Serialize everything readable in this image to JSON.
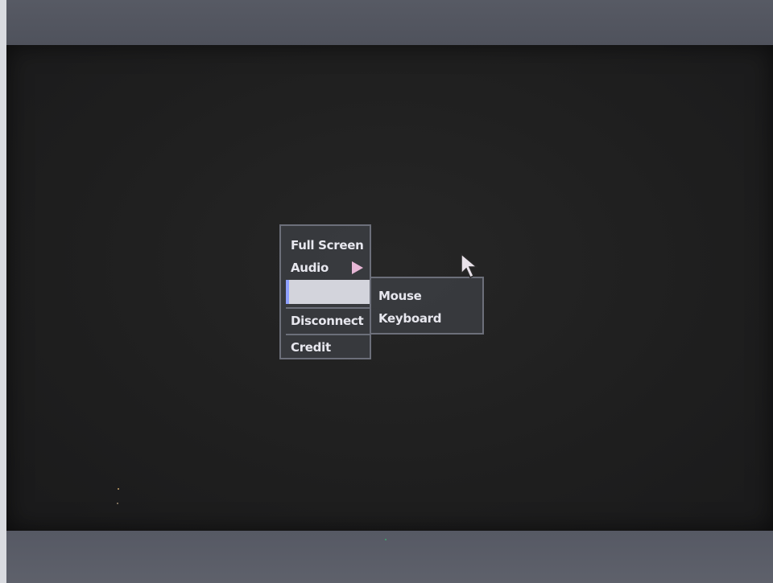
{
  "context_menu": {
    "items": [
      {
        "label": "Full Screen"
      },
      {
        "label": "Audio"
      },
      {
        "label": ""
      },
      {
        "label": "Disconnect"
      },
      {
        "label": "Credit"
      }
    ],
    "highlighted_index": 2
  },
  "submenu": {
    "items": [
      {
        "label": "Mouse"
      },
      {
        "label": "Keyboard"
      }
    ]
  },
  "icons": {
    "submenu_arrow": "chevron-right-icon",
    "pointer": "mouse-pointer-icon"
  },
  "colors": {
    "screen_background": "#1f1f1f",
    "menu_background": "#3a3c40",
    "menu_border": "#6c6f7a",
    "menu_text": "#e7e7ee",
    "highlight": "#d3d4dc",
    "arrow": "#e7b7d6"
  }
}
